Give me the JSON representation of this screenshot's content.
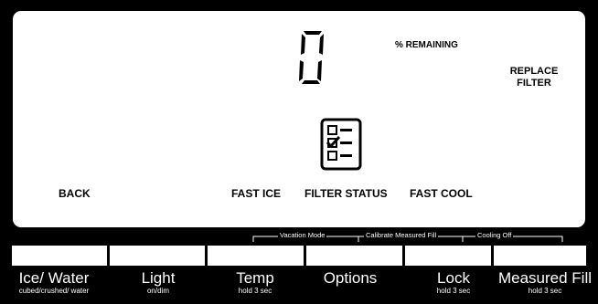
{
  "display": {
    "percent_remaining_label": "% REMAINING",
    "replace_filter_line1": "REPLACE",
    "replace_filter_line2": "FILTER",
    "back": "BACK",
    "fast_ice": "FAST ICE",
    "filter_status": "FILTER STATUS",
    "fast_cool": "FAST COOL",
    "digit_icon": "seven-segment-digit-icon",
    "filter_icon": "filter-checklist-icon"
  },
  "hold_functions": {
    "vacation_mode": "Vacation Mode",
    "calibrate_measured_fill": "Calibrate Measured Fill",
    "cooling_off": "Cooling Off"
  },
  "buttons": [
    {
      "label": "Ice/ Water",
      "sub": "cubed/crushed/ water"
    },
    {
      "label": "Light",
      "sub": "on/dim"
    },
    {
      "label": "Temp",
      "sub": "hold 3 sec"
    },
    {
      "label": "Options",
      "sub": ""
    },
    {
      "label": "Lock",
      "sub": "hold 3 sec"
    },
    {
      "label": "Measured Fill",
      "sub": "hold 3 sec"
    }
  ]
}
